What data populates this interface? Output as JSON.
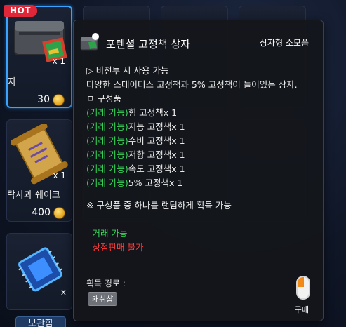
{
  "shop": {
    "hot_badge": "HOT",
    "cards": [
      {
        "name": "자",
        "price": "30",
        "qty": "x 1"
      },
      {
        "name": "락사과 쉐이크",
        "price": "400",
        "qty": "x 1"
      },
      {
        "name": "",
        "price": "",
        "qty": "x"
      }
    ],
    "bottom_button": "보관함"
  },
  "tooltip": {
    "title": "포텐셜 고정책 상자",
    "category": "상자형 소모품",
    "usage": "▷ 비전투 시 사용 가능",
    "description": "다양한 스테이터스 고정책과 5% 고정책이 들어있는 상자.",
    "contents_header": "ㅁ 구성품",
    "contents": [
      {
        "tag": "(거래 가능)",
        "item": "힘 고정책x 1"
      },
      {
        "tag": "(거래 가능)",
        "item": "지능 고정책x 1"
      },
      {
        "tag": "(거래 가능)",
        "item": "수비 고정책x 1"
      },
      {
        "tag": "(거래 가능)",
        "item": "저항 고정책x 1"
      },
      {
        "tag": "(거래 가능)",
        "item": "속도 고정책x 1"
      },
      {
        "tag": "(거래 가능)",
        "item": "5% 고정책x 1"
      }
    ],
    "random_note": "※ 구성품 중 하나를 랜덤하게 획득 가능",
    "tradeable": "- 거래 가능",
    "not_sellable": "- 상점판매 불가",
    "route_label": "획득 경로 :",
    "route_tag": "캐쉬샵",
    "buy_label": "구매"
  },
  "colors": {
    "green": "#35d657",
    "red": "#ff3b3b",
    "selected_border": "#3aa3ff",
    "hot_badge": "#e0273a"
  },
  "icons": [
    "treasure-box-icon",
    "scroll-icon",
    "chip-icon",
    "coin-icon",
    "mouse-left-click-icon"
  ]
}
